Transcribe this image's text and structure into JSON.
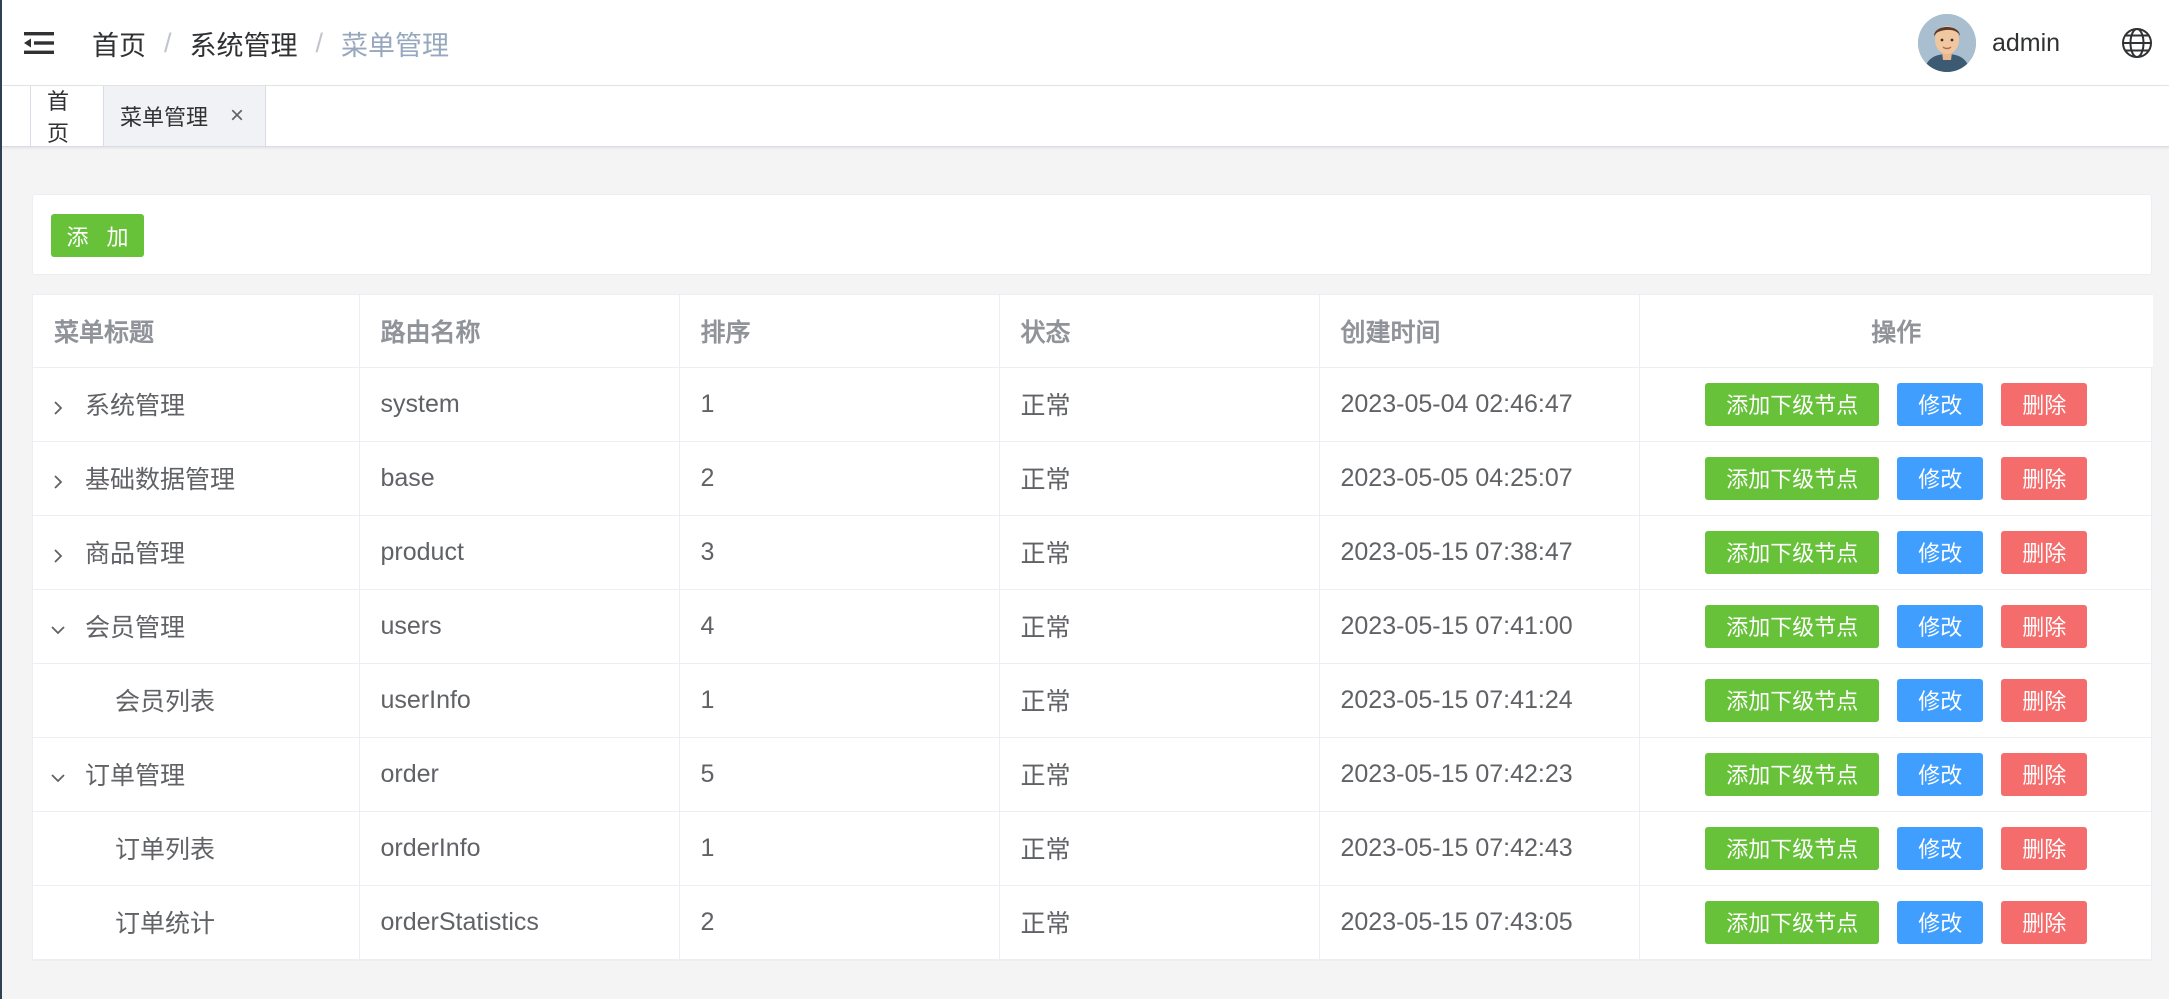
{
  "breadcrumb": {
    "home": "首页",
    "parent": "系统管理",
    "current": "菜单管理",
    "separator": "/"
  },
  "user": {
    "name": "admin"
  },
  "tags": {
    "home": "首页",
    "active": "菜单管理",
    "close": "×"
  },
  "toolbar": {
    "add_label": "添 加"
  },
  "table": {
    "headers": [
      "菜单标题",
      "路由名称",
      "排序",
      "状态",
      "创建时间",
      "操作"
    ],
    "rows": [
      {
        "title": "系统管理",
        "route": "system",
        "order": "1",
        "status": "正常",
        "created": "2023-05-04 02:46:47",
        "level": 0,
        "expander": "collapsed"
      },
      {
        "title": "基础数据管理",
        "route": "base",
        "order": "2",
        "status": "正常",
        "created": "2023-05-05 04:25:07",
        "level": 0,
        "expander": "collapsed"
      },
      {
        "title": "商品管理",
        "route": "product",
        "order": "3",
        "status": "正常",
        "created": "2023-05-15 07:38:47",
        "level": 0,
        "expander": "collapsed"
      },
      {
        "title": "会员管理",
        "route": "users",
        "order": "4",
        "status": "正常",
        "created": "2023-05-15 07:41:00",
        "level": 0,
        "expander": "expanded"
      },
      {
        "title": "会员列表",
        "route": "userInfo",
        "order": "1",
        "status": "正常",
        "created": "2023-05-15 07:41:24",
        "level": 1,
        "expander": "none"
      },
      {
        "title": "订单管理",
        "route": "order",
        "order": "5",
        "status": "正常",
        "created": "2023-05-15 07:42:23",
        "level": 0,
        "expander": "expanded"
      },
      {
        "title": "订单列表",
        "route": "orderInfo",
        "order": "1",
        "status": "正常",
        "created": "2023-05-15 07:42:43",
        "level": 1,
        "expander": "none"
      },
      {
        "title": "订单统计",
        "route": "orderStatistics",
        "order": "2",
        "status": "正常",
        "created": "2023-05-15 07:43:05",
        "level": 1,
        "expander": "none"
      }
    ],
    "actions": {
      "add_child": "添加下级节点",
      "edit": "修改",
      "delete": "删除"
    }
  },
  "colors": {
    "success": "#67c23a",
    "primary": "#409eff",
    "danger": "#f56c6c",
    "breadcrumb_current": "#97a8be"
  },
  "icons": {
    "menu": "hamburger-fold-icon",
    "language": "globe-icon",
    "collapsed": "chevron-right-icon",
    "expanded": "chevron-down-icon"
  }
}
